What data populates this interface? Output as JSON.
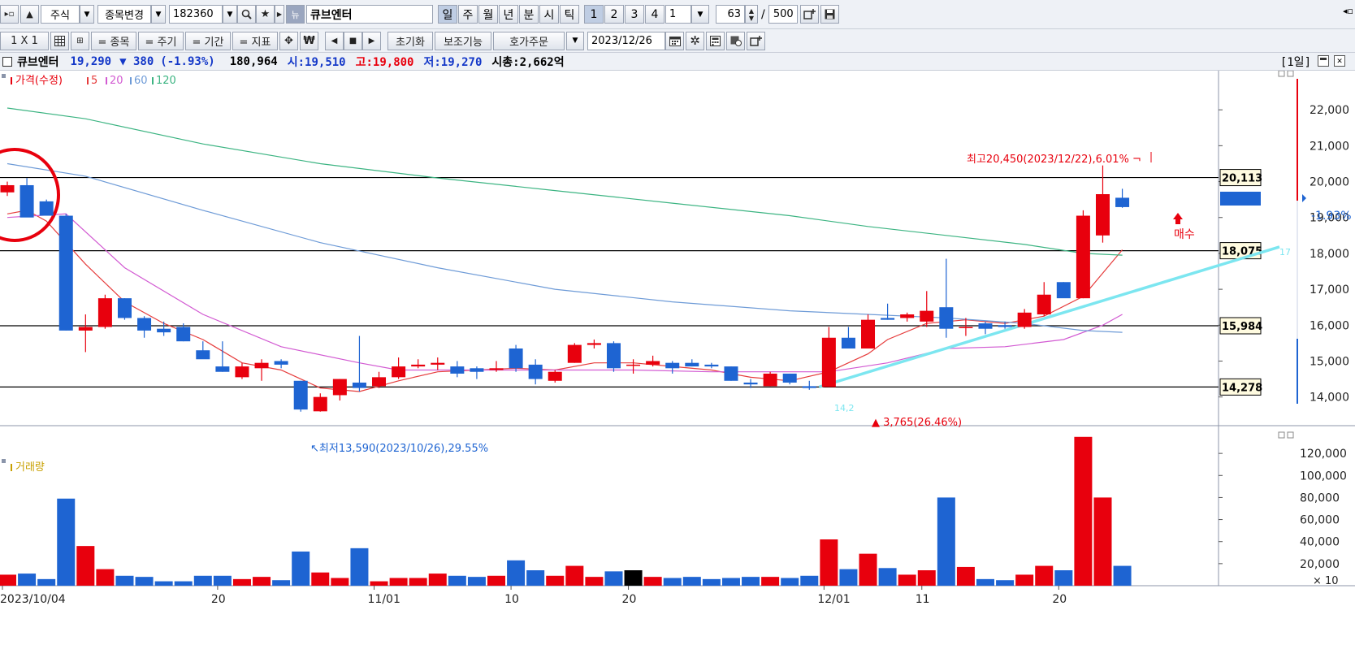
{
  "toolbar1": {
    "market": "주식",
    "change_item": "종목변경",
    "code": "182360",
    "badge": "뉴",
    "stock_name": "큐브엔터",
    "periods": [
      "일",
      "주",
      "월",
      "년",
      "분",
      "시",
      "틱"
    ],
    "numbers": [
      "1",
      "2",
      "3",
      "4"
    ],
    "period_value": "1",
    "count": "63",
    "slash": "/",
    "total": "500"
  },
  "toolbar2": {
    "layout": "1 X 1",
    "item_btn": "= 종목",
    "cycle_btn": "= 주기",
    "period_btn": "= 기간",
    "indicator_btn": "= 지표",
    "won_label": "₩",
    "reset": "초기화",
    "aux": "보조기능",
    "quote_order": "호가주문",
    "date": "2023/12/26"
  },
  "info": {
    "name": "큐브엔터",
    "price": "19,290",
    "change": "▼ 380",
    "change_pct": "(-1.93%)",
    "volume": "180,964",
    "open": "시:19,510",
    "high": "고:19,800",
    "low": "저:19,270",
    "mcap": "시총:2,662억",
    "interval": "[1일]"
  },
  "legend": {
    "price": "가격(수정)",
    "ma5": "5",
    "ma20": "20",
    "ma60": "60",
    "ma120": "120",
    "volume": "거래량"
  },
  "annotations": {
    "high": "최고20,450(2023/12/22),6.01%",
    "low": "최저13,590(2023/10/26),29.55%",
    "rise": "▲ 3,765(26.46%)",
    "buy": "매수",
    "price_tag": "19,290",
    "pct_tag": "-1.93%",
    "small_blue": "14,2",
    "right_edge": "17"
  },
  "hlines": [
    "20,113",
    "18,075",
    "15,984",
    "14,278"
  ],
  "colors": {
    "up": "#e8000d",
    "down": "#1e64d2",
    "ma5": "#e63c3c",
    "ma20": "#d25ad2",
    "ma60": "#6e9bd7",
    "ma120": "#3cb482",
    "trend": "#7ce6f0",
    "circle": "#e8000d"
  },
  "chart_data": {
    "type": "candlestick",
    "title": "",
    "ylim": [
      13200,
      23000
    ],
    "y_ticks": [
      14000,
      15000,
      16000,
      17000,
      18000,
      19000,
      20000,
      21000,
      22000
    ],
    "y_tick_labels": [
      "14,000",
      "15,000",
      "16,000",
      "17,000",
      "18,000",
      "19,000",
      "20,000",
      "21,000",
      "22,000"
    ],
    "x_ticks": [
      {
        "i": 0,
        "label": "2023/10/04"
      },
      {
        "i": 11,
        "label": "20"
      },
      {
        "i": 19,
        "label": "11/01"
      },
      {
        "i": 26,
        "label": "10"
      },
      {
        "i": 32,
        "label": "20"
      },
      {
        "i": 42,
        "label": "12/01"
      },
      {
        "i": 47,
        "label": "11"
      },
      {
        "i": 54,
        "label": "20"
      }
    ],
    "candles": [
      [
        19700,
        20000,
        19600,
        19900,
        10000
      ],
      [
        19900,
        20100,
        19050,
        19000,
        11000
      ],
      [
        19450,
        19500,
        19100,
        19050,
        6000
      ],
      [
        19050,
        19100,
        15850,
        15850,
        79000
      ],
      [
        15850,
        16300,
        15250,
        15950,
        36000
      ],
      [
        15950,
        16850,
        15900,
        16750,
        15000
      ],
      [
        16750,
        16750,
        16150,
        16200,
        9000
      ],
      [
        16200,
        16250,
        15650,
        15850,
        8000
      ],
      [
        15900,
        16100,
        15700,
        15800,
        4000
      ],
      [
        15950,
        16050,
        15550,
        15550,
        4000
      ],
      [
        15300,
        15550,
        15100,
        15050,
        9000
      ],
      [
        14850,
        15550,
        14700,
        14700,
        9000
      ],
      [
        14550,
        14950,
        14500,
        14850,
        6000
      ],
      [
        14800,
        15050,
        14450,
        14950,
        8000
      ],
      [
        15000,
        15050,
        14800,
        14900,
        5000
      ],
      [
        14450,
        14450,
        13590,
        13650,
        31000
      ],
      [
        13600,
        14100,
        13590,
        14000,
        12000
      ],
      [
        14050,
        14500,
        13900,
        14500,
        7000
      ],
      [
        14400,
        15700,
        14150,
        14250,
        34000
      ],
      [
        14300,
        14700,
        14250,
        14550,
        4000
      ],
      [
        14550,
        15100,
        14500,
        14850,
        7000
      ],
      [
        14850,
        15050,
        14800,
        14900,
        7000
      ],
      [
        14900,
        15100,
        14750,
        14950,
        11000
      ],
      [
        14850,
        15000,
        14550,
        14650,
        9000
      ],
      [
        14800,
        14850,
        14500,
        14700,
        8000
      ],
      [
        14750,
        15000,
        14700,
        14800,
        9000
      ],
      [
        15350,
        15450,
        14700,
        14800,
        23000
      ],
      [
        14900,
        15050,
        14350,
        14500,
        14000
      ],
      [
        14450,
        14750,
        14400,
        14700,
        9000
      ],
      [
        14950,
        15500,
        14950,
        15450,
        18000
      ],
      [
        15450,
        15600,
        15350,
        15500,
        8000
      ],
      [
        15500,
        15550,
        14700,
        14800,
        13000
      ],
      [
        14900,
        15050,
        14650,
        14900,
        14000
      ],
      [
        14900,
        15150,
        14850,
        15000,
        8000
      ],
      [
        14950,
        15000,
        14650,
        14800,
        7000
      ],
      [
        14950,
        15050,
        14850,
        14850,
        8000
      ],
      [
        14900,
        14950,
        14800,
        14850,
        6000
      ],
      [
        14850,
        14850,
        14450,
        14450,
        7000
      ],
      [
        14400,
        14500,
        14250,
        14350,
        8000
      ],
      [
        14300,
        14700,
        14300,
        14650,
        8000
      ],
      [
        14650,
        14650,
        14350,
        14400,
        7000
      ],
      [
        14300,
        14450,
        14200,
        14250,
        9000
      ],
      [
        14278,
        15950,
        14278,
        15650,
        42000
      ],
      [
        15650,
        15950,
        15400,
        15350,
        15000
      ],
      [
        15350,
        16300,
        15350,
        16150,
        29000
      ],
      [
        16200,
        16600,
        16150,
        16150,
        16000
      ],
      [
        16200,
        16350,
        16100,
        16300,
        10000
      ],
      [
        16100,
        16950,
        15950,
        16400,
        14000
      ],
      [
        16500,
        17850,
        15650,
        15900,
        80000
      ],
      [
        15950,
        16200,
        15700,
        15950,
        17000
      ],
      [
        16050,
        16100,
        15750,
        15900,
        6000
      ],
      [
        16000,
        16100,
        15900,
        15950,
        5000
      ],
      [
        15950,
        16450,
        15900,
        16350,
        10000
      ],
      [
        16300,
        17200,
        16250,
        16850,
        18000
      ],
      [
        17200,
        17200,
        16800,
        16750,
        14000
      ],
      [
        16750,
        19200,
        16750,
        19050,
        135000
      ],
      [
        18500,
        20450,
        18300,
        19650,
        80000
      ],
      [
        19550,
        19800,
        19270,
        19290,
        18000
      ]
    ],
    "series": [
      {
        "name": "5",
        "values": [
          [
            0,
            19100
          ],
          [
            1,
            19200
          ],
          [
            2,
            18900
          ],
          [
            4,
            17700
          ],
          [
            6,
            16650
          ],
          [
            8,
            16050
          ],
          [
            10,
            15600
          ],
          [
            12,
            14950
          ],
          [
            14,
            14750
          ],
          [
            16,
            14250
          ],
          [
            18,
            14150
          ],
          [
            20,
            14450
          ],
          [
            22,
            14700
          ],
          [
            24,
            14750
          ],
          [
            26,
            14800
          ],
          [
            28,
            14750
          ],
          [
            30,
            14950
          ],
          [
            32,
            14950
          ],
          [
            34,
            14850
          ],
          [
            36,
            14750
          ],
          [
            38,
            14550
          ],
          [
            40,
            14450
          ],
          [
            42,
            14700
          ],
          [
            44,
            15200
          ],
          [
            45,
            15600
          ],
          [
            47,
            16050
          ],
          [
            49,
            16150
          ],
          [
            51,
            16050
          ],
          [
            53,
            16250
          ],
          [
            55,
            16800
          ],
          [
            57,
            18100
          ]
        ]
      },
      {
        "name": "20",
        "values": [
          [
            0,
            19000
          ],
          [
            3,
            19100
          ],
          [
            6,
            17600
          ],
          [
            10,
            16300
          ],
          [
            14,
            15400
          ],
          [
            18,
            14950
          ],
          [
            20,
            14750
          ],
          [
            24,
            14750
          ],
          [
            28,
            14750
          ],
          [
            32,
            14750
          ],
          [
            36,
            14700
          ],
          [
            40,
            14700
          ],
          [
            42,
            14700
          ],
          [
            45,
            14950
          ],
          [
            48,
            15350
          ],
          [
            51,
            15400
          ],
          [
            54,
            15600
          ],
          [
            56,
            16000
          ],
          [
            57,
            16300
          ]
        ]
      },
      {
        "name": "60",
        "values": [
          [
            0,
            20500
          ],
          [
            4,
            20150
          ],
          [
            10,
            19200
          ],
          [
            16,
            18300
          ],
          [
            22,
            17600
          ],
          [
            28,
            17000
          ],
          [
            34,
            16650
          ],
          [
            40,
            16400
          ],
          [
            44,
            16300
          ],
          [
            48,
            16200
          ],
          [
            52,
            16050
          ],
          [
            55,
            15850
          ],
          [
            57,
            15800
          ]
        ]
      },
      {
        "name": "120",
        "values": [
          [
            0,
            22050
          ],
          [
            4,
            21750
          ],
          [
            10,
            21050
          ],
          [
            16,
            20500
          ],
          [
            22,
            20100
          ],
          [
            28,
            19750
          ],
          [
            34,
            19400
          ],
          [
            40,
            19050
          ],
          [
            44,
            18750
          ],
          [
            48,
            18500
          ],
          [
            52,
            18250
          ],
          [
            55,
            18000
          ],
          [
            57,
            17950
          ]
        ]
      }
    ],
    "volume_ylim": [
      0,
      140000
    ],
    "volume_ticks": [
      "20,000",
      "40,000",
      "60,000",
      "80,000",
      "100,000",
      "120,000"
    ],
    "volume_unit": "× 10"
  }
}
